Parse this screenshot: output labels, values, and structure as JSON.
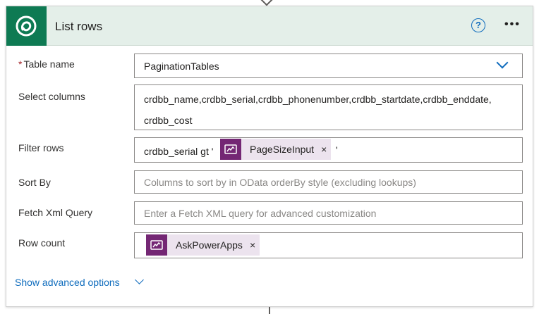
{
  "header": {
    "title": "List rows",
    "logo_icon": "dataverse-logo-icon",
    "help_icon": "?",
    "more_icon": "•••"
  },
  "fields": {
    "table_name": {
      "required_mark": "*",
      "label": "Table name",
      "value": "PaginationTables"
    },
    "select_columns": {
      "label": "Select columns",
      "value_line1": "crdbb_name,crdbb_serial,crdbb_phonenumber,crdbb_startdate,crdbb_enddate,",
      "value_line2": "crdbb_cost"
    },
    "filter_rows": {
      "label": "Filter rows",
      "prefix": "crdbb_serial gt '",
      "token": "PageSizeInput",
      "token_close": "×",
      "suffix": "'"
    },
    "sort_by": {
      "label": "Sort By",
      "placeholder": "Columns to sort by in OData orderBy style (excluding lookups)"
    },
    "fetch_xml": {
      "label": "Fetch Xml Query",
      "placeholder": "Enter a Fetch XML query for advanced customization"
    },
    "row_count": {
      "label": "Row count",
      "token": "AskPowerApps",
      "token_close": "×"
    }
  },
  "advanced": {
    "label": "Show advanced options"
  },
  "colors": {
    "header_bg": "#e4efe9",
    "logo_bg": "#0e7a53",
    "link": "#0f6cbd",
    "token_bg": "#ece3ee",
    "token_icon_bg": "#742774",
    "required": "#a4262c"
  }
}
